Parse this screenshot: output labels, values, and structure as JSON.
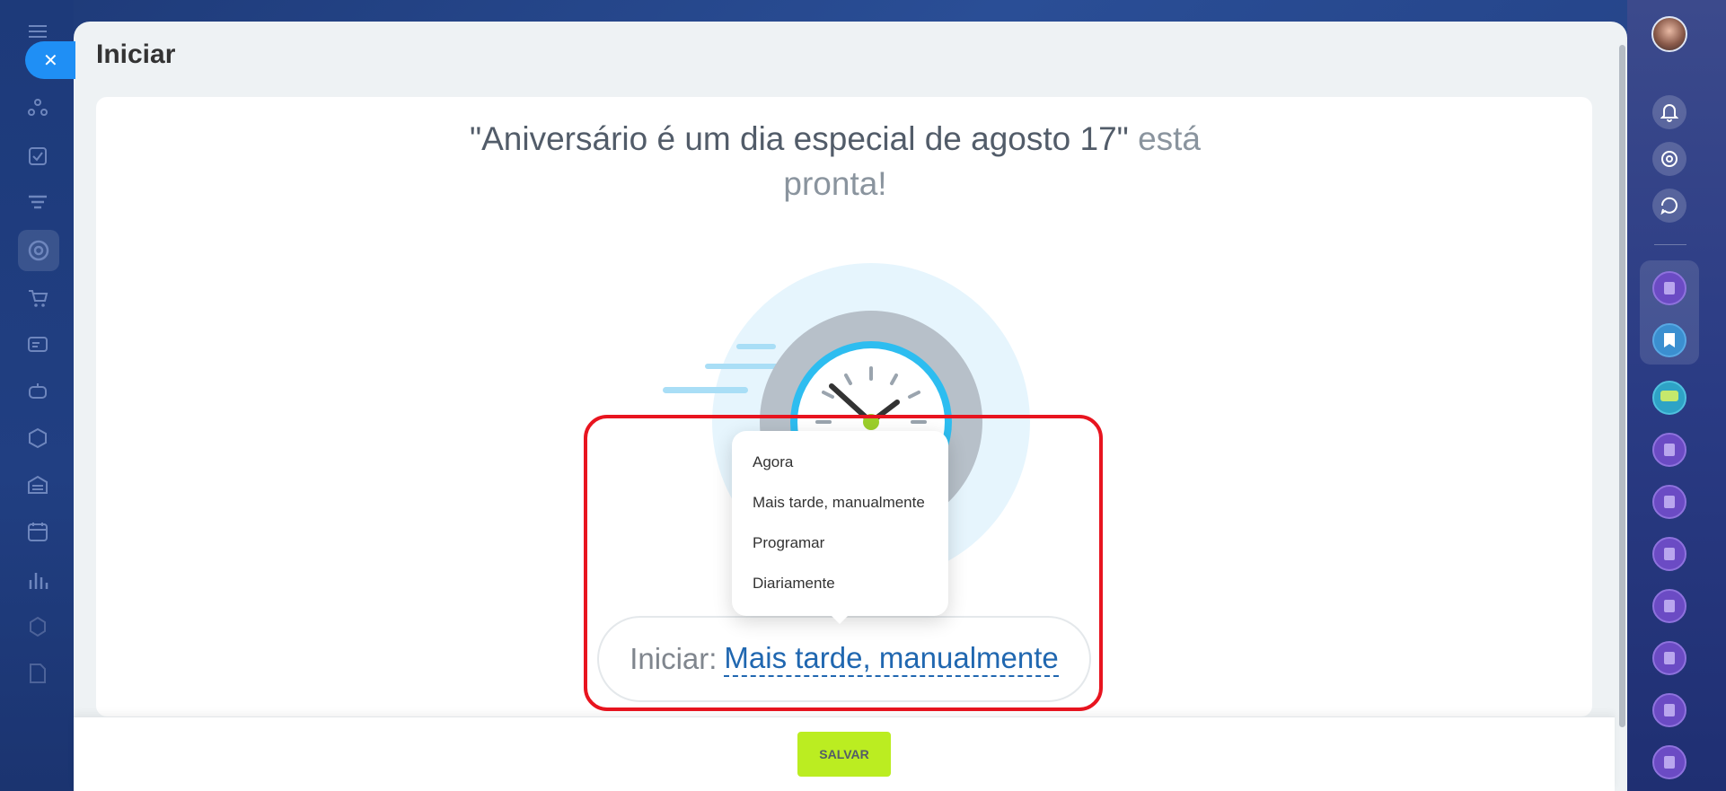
{
  "page": {
    "title": "Iniciar",
    "headline_name": "\"Aniversário é um dia especial de agosto 17\"",
    "headline_rest": "está pronta!"
  },
  "start": {
    "label": "Iniciar:",
    "selected": "Mais tarde, manualmente"
  },
  "dropdown": {
    "options": [
      "Agora",
      "Mais tarde, manualmente",
      "Programar",
      "Diariamente"
    ]
  },
  "footer": {
    "save_label": "SALVAR"
  },
  "left_sidebar": {
    "icons": [
      "menu-icon",
      "crm-icon",
      "tasks-icon",
      "funnel-icon",
      "marketing-icon",
      "cart-icon",
      "contact-center-icon",
      "robot-icon",
      "box-icon",
      "warehouse-icon",
      "calendar-icon",
      "analytics-icon",
      "settings-icon",
      "document-icon"
    ]
  },
  "right_sidebar": {
    "icons": [
      "avatar",
      "bell-icon",
      "target-icon",
      "chat-sync-icon",
      "contact-icon",
      "bookmark-icon",
      "chat-icon",
      "contact-icon",
      "contact-icon",
      "contact-icon",
      "contact-icon",
      "contact-icon",
      "contact-icon",
      "contact-icon"
    ]
  },
  "colors": {
    "accent_blue": "#2067b0",
    "highlight_red": "#e8141f",
    "save_green": "#bbed21"
  }
}
